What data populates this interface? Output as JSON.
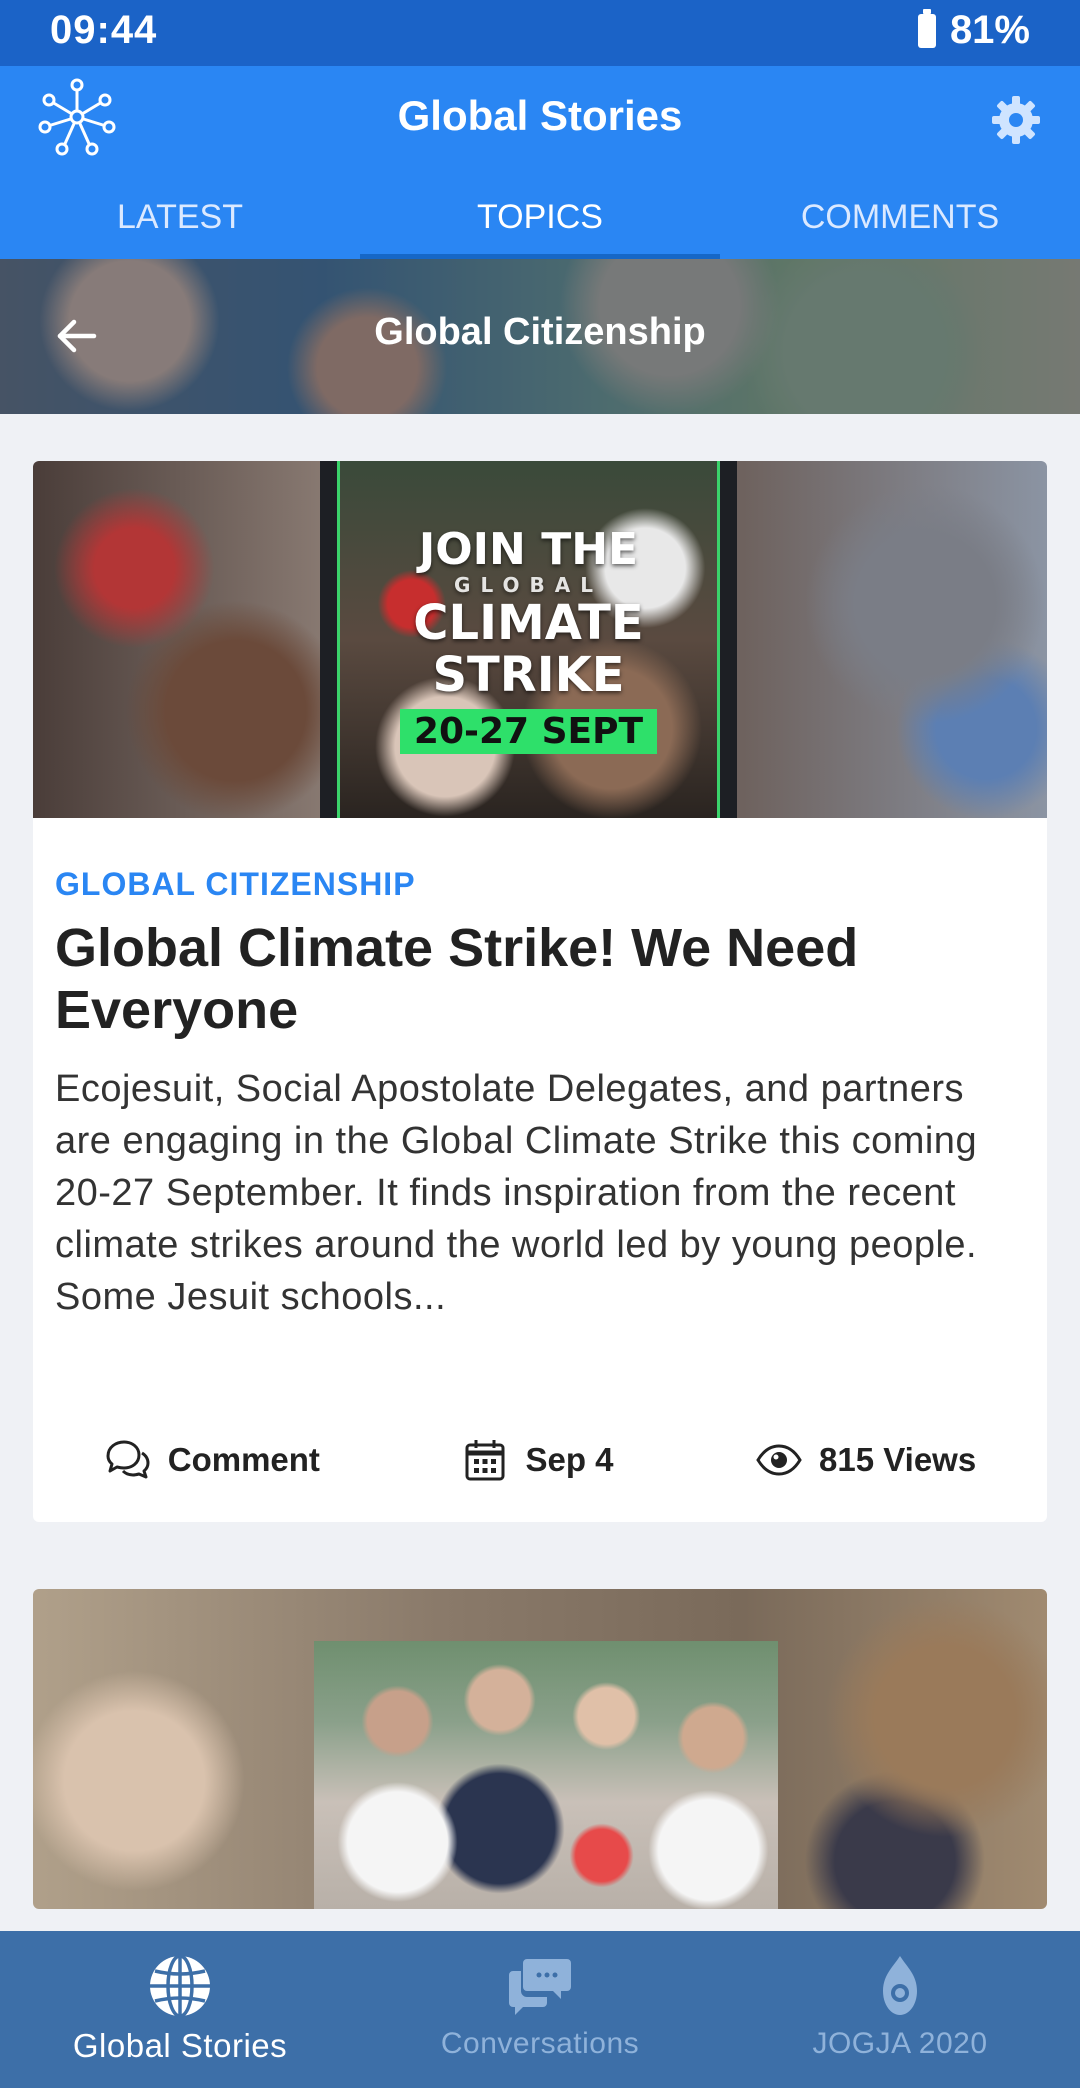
{
  "status_bar": {
    "time": "09:44",
    "battery": "81%"
  },
  "header": {
    "title": "Global Stories",
    "tabs": [
      {
        "label": "LATEST",
        "active": false
      },
      {
        "label": "TOPICS",
        "active": true
      },
      {
        "label": "COMMENTS",
        "active": false
      }
    ]
  },
  "topic": {
    "title": "Global Citizenship"
  },
  "articles": [
    {
      "hero_poster": {
        "line1": "JOIN THE",
        "line2": "GLOBAL",
        "line3a": "CLIMATE",
        "line3b": "STRIKE",
        "date": "20-27 SEPT"
      },
      "category": "GLOBAL CITIZENSHIP",
      "title": "Global Climate Strike! We Need Everyone",
      "excerpt": "Ecojesuit, Social Apostolate Delegates, and partners are engaging in the Global Climate Strike this coming 20-27 September. It finds inspiration from the recent climate strikes around the world led by young people. Some Jesuit schools...",
      "comment_label": "Comment",
      "date": "Sep 4",
      "views": "815 Views"
    }
  ],
  "bottom_nav": [
    {
      "label": "Global Stories",
      "icon": "globe-icon",
      "active": true
    },
    {
      "label": "Conversations",
      "icon": "chat-icon",
      "active": false
    },
    {
      "label": "JOGJA 2020",
      "icon": "emblem-icon",
      "active": false
    }
  ],
  "colors": {
    "primary": "#2a86f3",
    "status_bar": "#1b63c7",
    "bottom_nav": "#3d6fa8",
    "background": "#eff1f5"
  }
}
